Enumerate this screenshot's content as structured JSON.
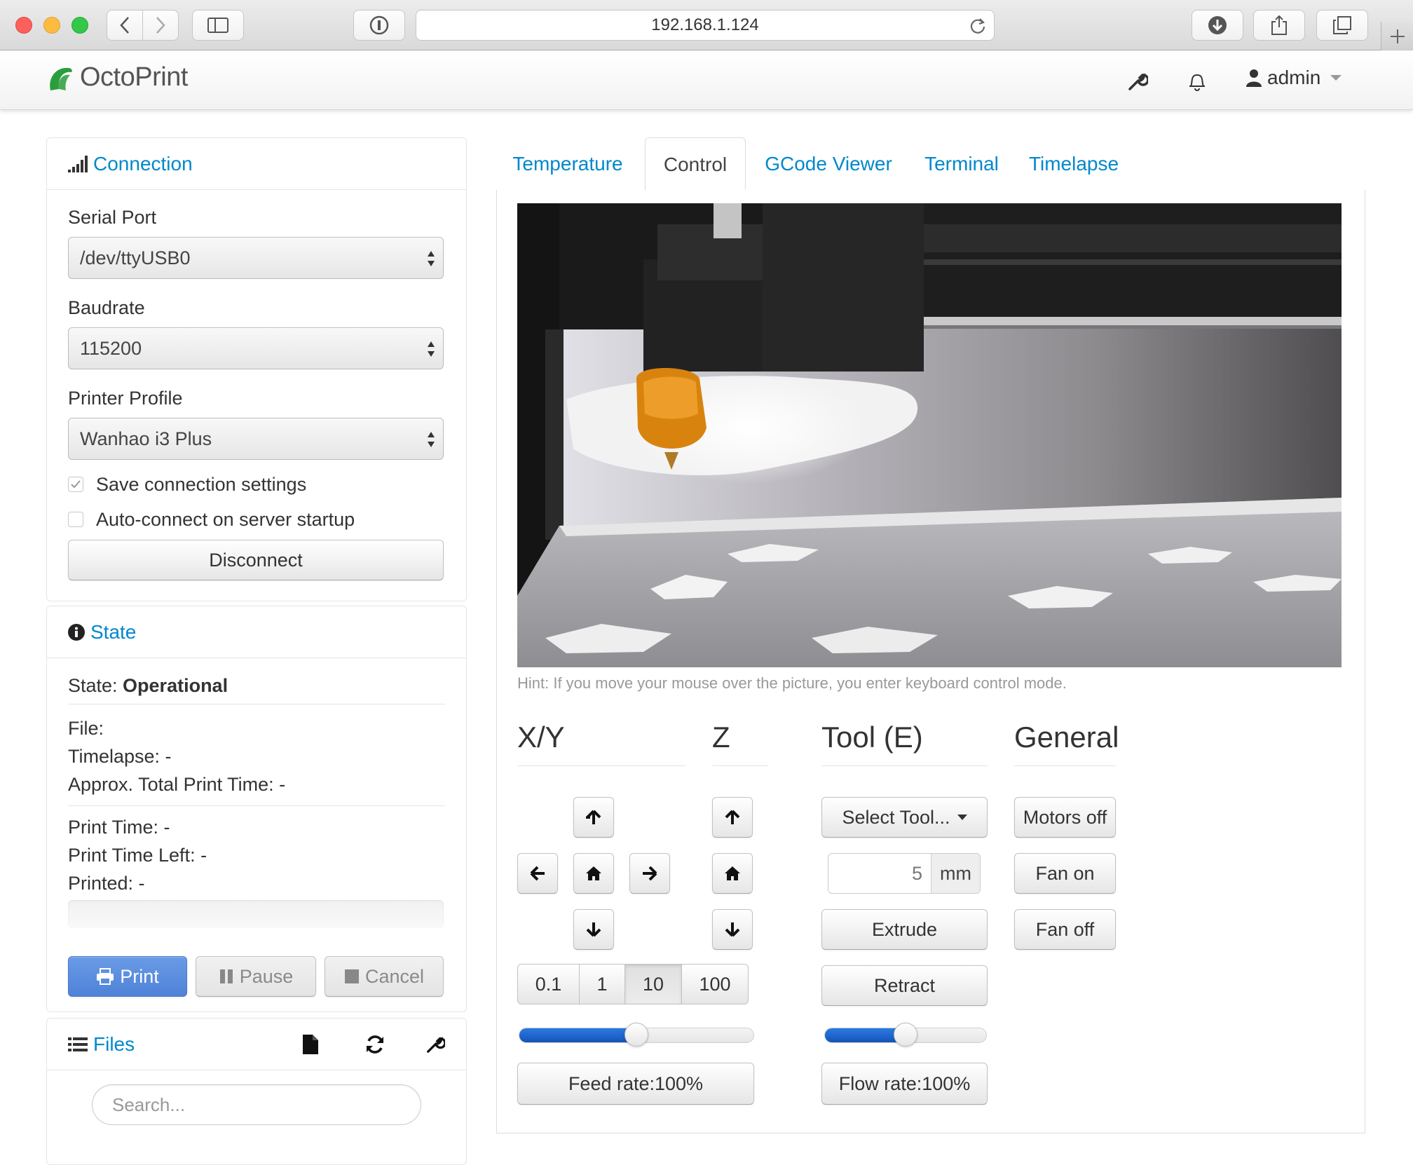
{
  "browser": {
    "url": "192.168.1.124"
  },
  "app": {
    "brand": "OctoPrint",
    "user": "admin",
    "brand_color": "#2a9e3c",
    "link_color": "#0088cc"
  },
  "connection": {
    "title": "Connection",
    "serial_port_label": "Serial Port",
    "serial_port_value": "/dev/ttyUSB0",
    "baudrate_label": "Baudrate",
    "baudrate_value": "115200",
    "profile_label": "Printer Profile",
    "profile_value": "Wanhao i3 Plus",
    "save_settings_label": "Save connection settings",
    "save_settings_checked": true,
    "autoconnect_label": "Auto-connect on server startup",
    "autoconnect_checked": false,
    "disconnect_button": "Disconnect"
  },
  "state": {
    "title": "State",
    "state_label": "State: ",
    "state_value": "Operational",
    "file": "File:",
    "timelapse": "Timelapse: -",
    "approx_total": "Approx. Total Print Time: -",
    "print_time": "Print Time: -",
    "print_time_left": "Print Time Left: -",
    "printed": "Printed: -",
    "print_button": "Print",
    "pause_button": "Pause",
    "cancel_button": "Cancel"
  },
  "files": {
    "title": "Files",
    "search_placeholder": "Search..."
  },
  "tabs": [
    "Temperature",
    "Control",
    "GCode Viewer",
    "Terminal",
    "Timelapse"
  ],
  "active_tab": "Control",
  "control": {
    "hint": "Hint: If you move your mouse over the picture, you enter keyboard control mode.",
    "headings": {
      "xy": "X/Y",
      "z": "Z",
      "tool": "Tool (E)",
      "general": "General"
    },
    "distances": [
      "0.1",
      "1",
      "10",
      "100"
    ],
    "selected_distance": "10",
    "select_tool": "Select Tool...",
    "extrude_amount": "5",
    "extrude_unit": "mm",
    "extrude_button": "Extrude",
    "retract_button": "Retract",
    "feed_rate_button": "Feed rate:100%",
    "flow_rate_button": "Flow rate:100%",
    "feed_rate_slider_fraction": 0.5,
    "flow_rate_slider_fraction": 0.5,
    "motors_off_button": "Motors off",
    "fan_on_button": "Fan on",
    "fan_off_button": "Fan off"
  }
}
